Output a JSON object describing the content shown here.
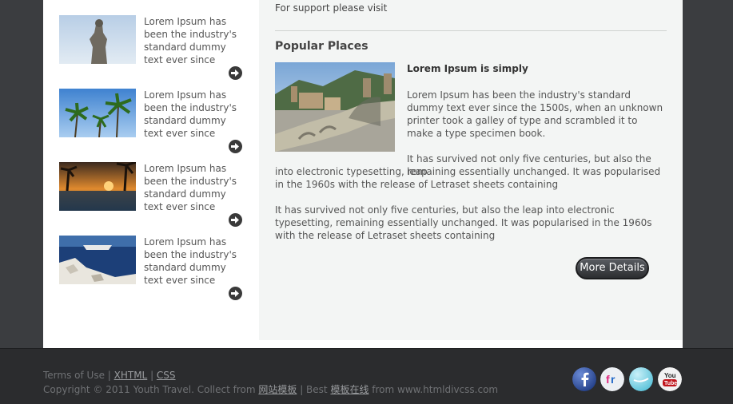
{
  "sidebar": {
    "items": [
      {
        "text": "Lorem Ipsum has been the industry's standard dummy text ever since",
        "thumb": "statue-photo-icon"
      },
      {
        "text": "Lorem Ipsum has been the industry's standard dummy text ever since",
        "thumb": "palm-trees-photo-icon"
      },
      {
        "text": "Lorem Ipsum has been the industry's standard dummy text ever since",
        "thumb": "sunset-pool-photo-icon"
      },
      {
        "text": "Lorem Ipsum has been the industry's standard dummy text ever since",
        "thumb": "cruise-coast-photo-icon"
      }
    ]
  },
  "main": {
    "support_text": "For support please visit",
    "section_title": "Popular Places",
    "feature_heading": "Lorem Ipsum is simply",
    "para1": "Lorem Ipsum has been the industry's standard dummy text ever since the 1500s, when an unknown printer took a galley of type and scrambled it to make a type specimen book.",
    "para2_first": "It has survived not only five centuries, but also the leap",
    "para2_rest": "into electronic typesetting, remaining essentially unchanged. It was popularised in the 1960s with the release of Letraset sheets containing",
    "para3": "It has survived not only five centuries, but also the leap into electronic typesetting, remaining essentially unchanged. It was popularised in the 1960s with the release of Letraset sheets containing",
    "more_button": "More Details"
  },
  "footer": {
    "terms": "Terms of Use",
    "sep1": " | ",
    "xhtml": "XHTML",
    "sep2": " | ",
    "css": "CSS",
    "copy_prefix": "Copyright © 2011 Youth Travel. Collect from ",
    "link1": "网站模板",
    "copy_mid": " | Best ",
    "link2": "模板在线",
    "copy_suffix": " from www.htmldivcss.com"
  },
  "social": [
    {
      "name": "facebook-icon",
      "label": "f",
      "color": "#2d4d9a"
    },
    {
      "name": "flickr-icon",
      "label": "fr",
      "color": "#f2f2f2"
    },
    {
      "name": "twitter-icon",
      "label": "tw",
      "color": "#7fd3e6"
    },
    {
      "name": "youtube-icon",
      "label": "You Tube",
      "color": "#c0141b"
    }
  ]
}
